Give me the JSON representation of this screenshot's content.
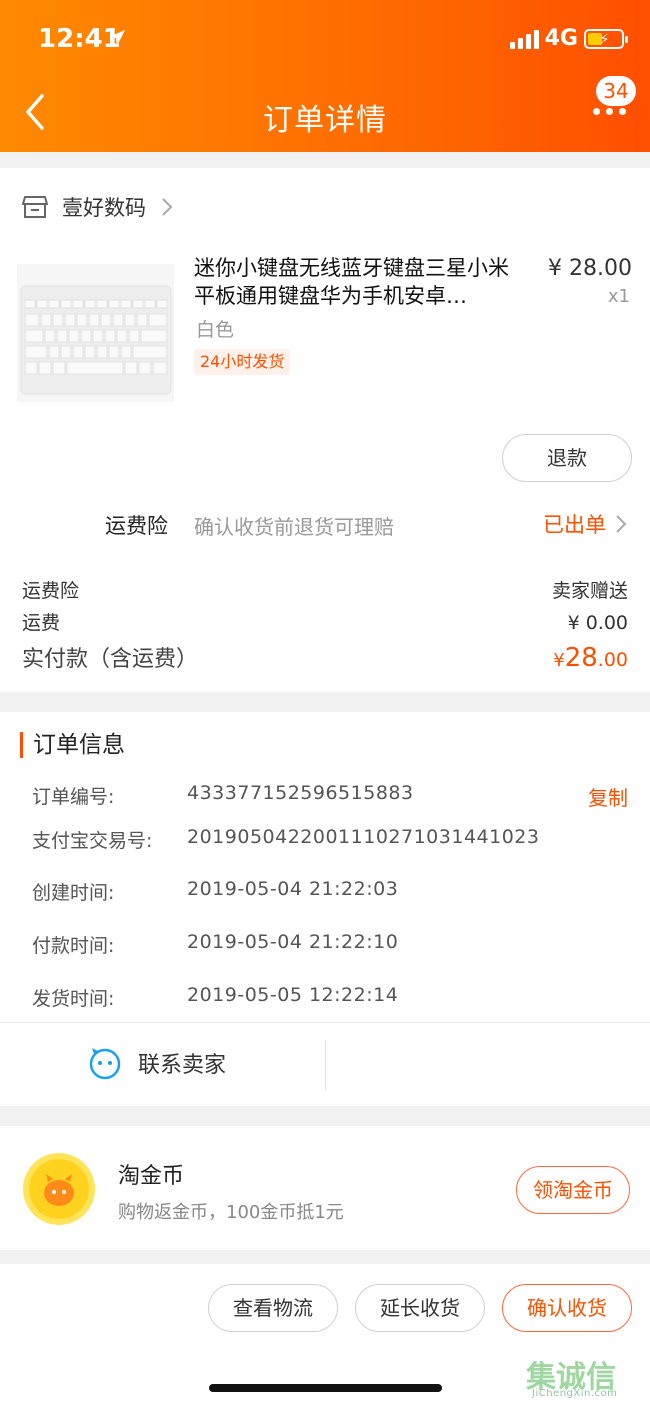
{
  "status_bar": {
    "time": "12:41",
    "network": "4G"
  },
  "nav": {
    "title": "订单详情",
    "badge": "34"
  },
  "shop": {
    "name": "壹好数码"
  },
  "product": {
    "title": "迷你小键盘无线蓝牙键盘三星小米平板通用键盘华为手机安卓…",
    "price": "¥ 28.00",
    "qty": "x1",
    "spec": "白色",
    "tag": "24小时发货",
    "refund_label": "退款"
  },
  "insurance": {
    "label": "运费险",
    "desc": "确认收货前退货可理赔",
    "status": "已出单"
  },
  "summary": {
    "insurance_label": "运费险",
    "insurance_value": "卖家赠送",
    "shipping_label": "运费",
    "shipping_value": "¥ 0.00",
    "total_label": "实付款（含运费）",
    "total_currency": "¥",
    "total_int": "28",
    "total_dec": ".00"
  },
  "order_info": {
    "title": "订单信息",
    "copy_label": "复制",
    "rows": [
      {
        "key": "订单编号:",
        "value": "433377152596515883"
      },
      {
        "key": "支付宝交易号:",
        "value": "2019050422001110271031441023"
      },
      {
        "key": "创建时间:",
        "value": "2019-05-04 21:22:03"
      },
      {
        "key": "付款时间:",
        "value": "2019-05-04 21:22:10"
      },
      {
        "key": "发货时间:",
        "value": "2019-05-05 12:22:14"
      }
    ],
    "contact_label": "联系卖家"
  },
  "coins": {
    "title": "淘金币",
    "desc": "购物返金币，100金币抵1元",
    "button": "领淘金币"
  },
  "actions": {
    "logistics": "查看物流",
    "extend": "延长收货",
    "confirm": "确认收货"
  },
  "watermark": {
    "main": "集诚信",
    "sub": "JiChengXin.com"
  },
  "colors": {
    "accent": "#ff5000",
    "header_start": "#ff8a00",
    "header_end": "#ff4f00"
  }
}
